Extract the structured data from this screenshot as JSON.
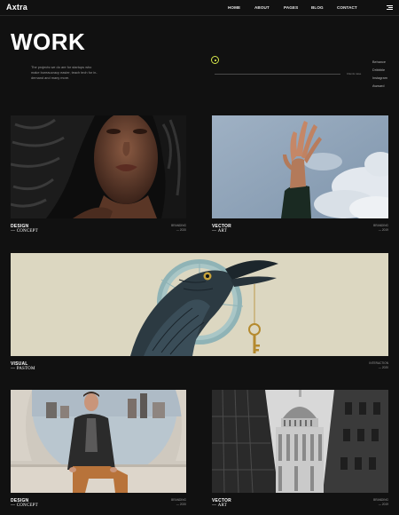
{
  "nav": {
    "logo": "Axtra",
    "items": [
      {
        "label": "HOME"
      },
      {
        "label": "ABOUT"
      },
      {
        "label": "PAGES"
      },
      {
        "label": "BLOG"
      },
      {
        "label": "CONTACT"
      }
    ],
    "menu_icon": "hamburger-icon"
  },
  "hero": {
    "title": "WORK",
    "description": "The projects we do are for startups who make bureaucracy easier, teach tech for in-demand and many more.",
    "line_label": "Clients case",
    "dot_icon": "target-dot-icon",
    "accent_color": "#d4e64a",
    "socials": [
      "Behance",
      "Dribbble",
      "Instagram",
      "Awward"
    ]
  },
  "projects": [
    {
      "title": "DESIGN",
      "subtitle": "CONCEPT",
      "category": "BRANDING",
      "year": "2020",
      "image": "woman-portrait"
    },
    {
      "title": "VECTOR",
      "subtitle": "ART",
      "category": "BRANDING",
      "year": "2019",
      "image": "hand-sky"
    },
    {
      "title": "VISUAL",
      "subtitle": "PASTOM",
      "category": "INTERACTION",
      "year": "2020",
      "image": "crow-key"
    },
    {
      "title": "DESIGN",
      "subtitle": "CONCEPT",
      "category": "BRANDING",
      "year": "2020",
      "image": "man-sitting"
    },
    {
      "title": "VECTOR",
      "subtitle": "ART",
      "category": "BRANDING",
      "year": "2019",
      "image": "cathedral"
    }
  ],
  "colors": {
    "background": "#111111",
    "text": "#ffffff",
    "muted": "#9a9a9a"
  }
}
